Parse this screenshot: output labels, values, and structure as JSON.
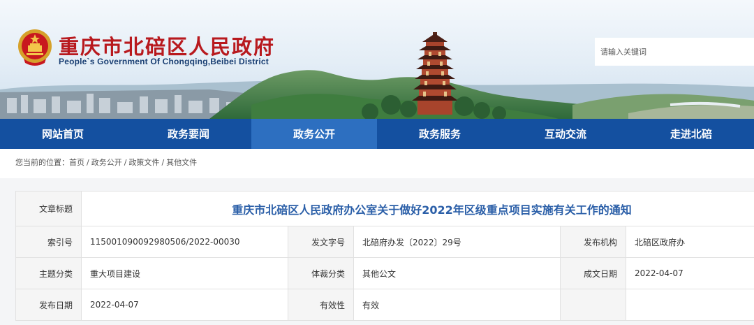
{
  "header": {
    "site_title": "重庆市北碚区人民政府",
    "site_subtitle": "People`s Government Of Chongqing,Beibei District",
    "search_placeholder": "请输入关键词"
  },
  "nav": {
    "items": [
      "网站首页",
      "政务要闻",
      "政务公开",
      "政务服务",
      "互动交流",
      "走进北碚"
    ],
    "active_index": 2
  },
  "breadcrumb": {
    "lead": "您当前的位置：",
    "items": [
      "首页",
      "政务公开",
      "政策文件",
      "其他文件"
    ],
    "separator": "/"
  },
  "info": {
    "title_label": "文章标题",
    "title": "重庆市北碚区人民政府办公室关于做好2022年区级重点项目实施有关工作的通知",
    "index_label": "索引号",
    "index": "115001090092980506/2022-00030",
    "doc_no_label": "发文字号",
    "doc_no": "北碚府办发〔2022〕29号",
    "issuer_label": "发布机构",
    "issuer": "北碚区政府办",
    "topic_label": "主题分类",
    "topic": "重大项目建设",
    "genre_label": "体裁分类",
    "genre": "其他公文",
    "created_label": "成文日期",
    "created": "2022-04-07",
    "published_label": "发布日期",
    "published": "2022-04-07",
    "validity_label": "有效性",
    "validity": "有效"
  },
  "colors": {
    "nav_bg": "#1450a0",
    "nav_active": "#2d6fc0",
    "title_red": "#b8191e",
    "doc_title_blue": "#2b5fa8"
  }
}
